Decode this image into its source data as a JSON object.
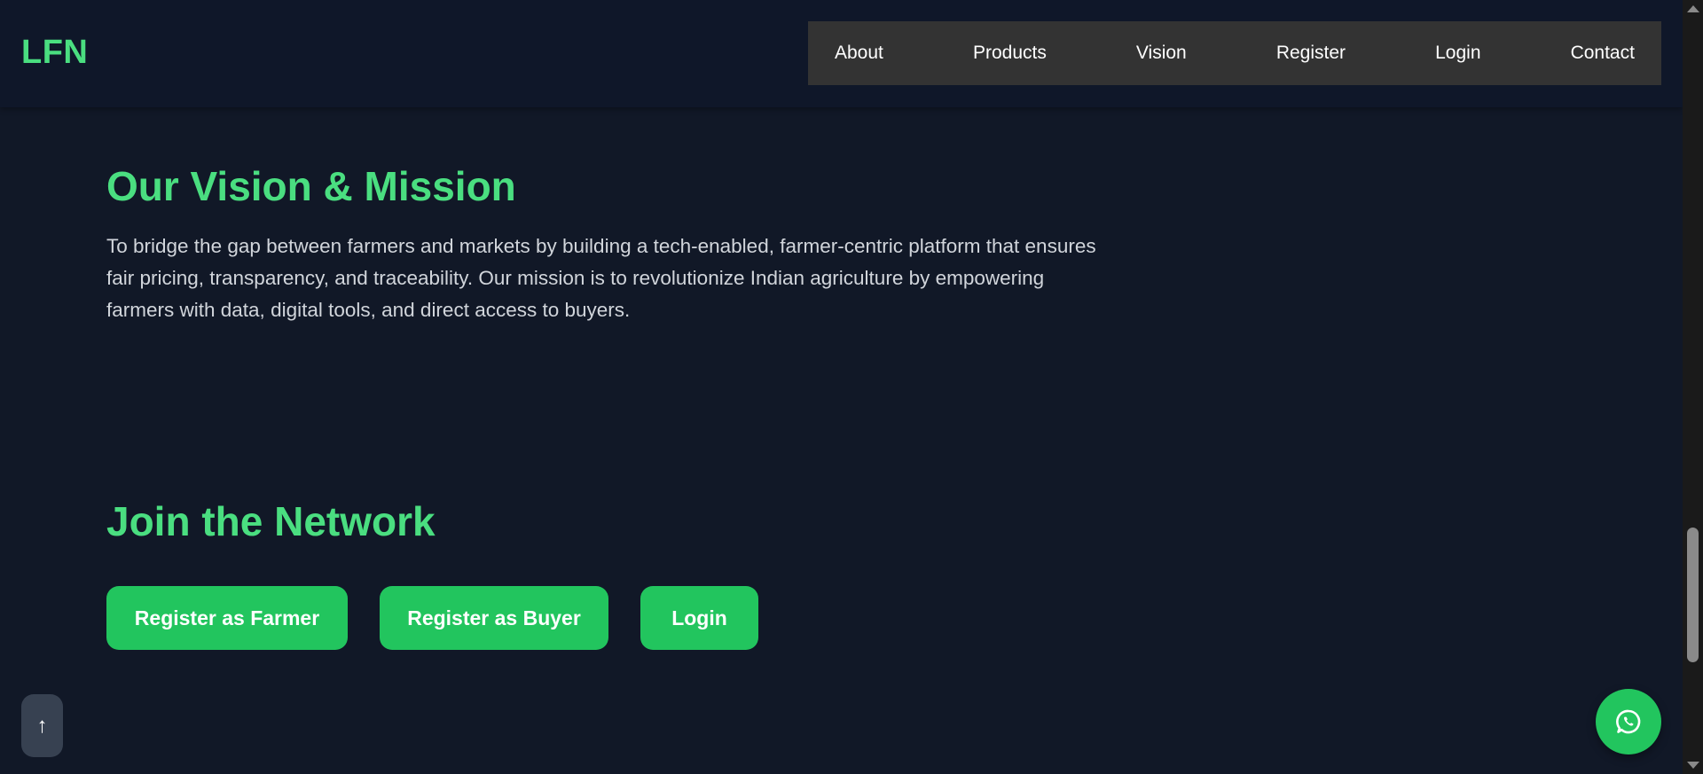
{
  "header": {
    "logo": "LFN",
    "nav": [
      {
        "label": "About"
      },
      {
        "label": "Products"
      },
      {
        "label": "Vision"
      },
      {
        "label": "Register"
      },
      {
        "label": "Login"
      },
      {
        "label": "Contact"
      }
    ]
  },
  "vision": {
    "title": "Our Vision & Mission",
    "text": "To bridge the gap between farmers and markets by building a tech-enabled, farmer-centric platform that ensures fair pricing, transparency, and traceability. Our mission is to revolutionize Indian agriculture by empowering farmers with data, digital tools, and direct access to buyers."
  },
  "join": {
    "title": "Join the Network",
    "buttons": {
      "farmer": "Register as Farmer",
      "buyer": "Register as Buyer",
      "login": "Login"
    }
  },
  "floating": {
    "scroll_top_glyph": "↑",
    "whatsapp_icon": "whatsapp-icon"
  },
  "colors": {
    "background": "#111827",
    "accent": "#4ade80",
    "button": "#22c55e",
    "nav_bg": "#333333",
    "text": "#d1d5db"
  }
}
